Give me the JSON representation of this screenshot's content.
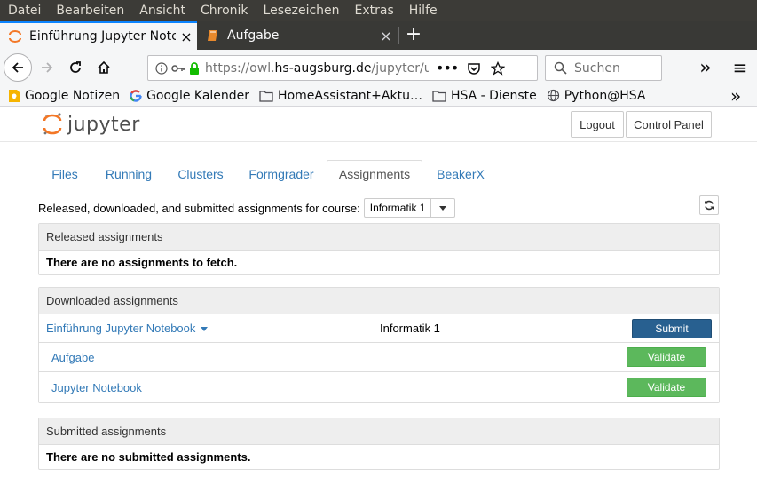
{
  "browser": {
    "menu": [
      "Datei",
      "Bearbeiten",
      "Ansicht",
      "Chronik",
      "Lesezeichen",
      "Extras",
      "Hilfe"
    ],
    "tabs": [
      {
        "title": "Einführung Jupyter Notebook",
        "close": "×"
      },
      {
        "title": "Aufgabe",
        "close": "×"
      }
    ],
    "new_tab": "+",
    "url_prefix": "https://owl.",
    "url_domain": "hs-augsburg.de",
    "url_path": "/jupyter/u",
    "search_placeholder": "Suchen",
    "overflow": "»",
    "menu_icon": "≡",
    "bookmarks": [
      {
        "label": "Google Notizen",
        "icon": "keep-icon"
      },
      {
        "label": "Google Kalender",
        "icon": "google-icon"
      },
      {
        "label": "HomeAssistant+Aktu…",
        "icon": "folder-icon"
      },
      {
        "label": "HSA - Dienste",
        "icon": "folder-icon"
      },
      {
        "label": "Python@HSA",
        "icon": "globe-icon"
      }
    ],
    "bookmarks_overflow": "»"
  },
  "jupyter": {
    "logo_text": "jupyter",
    "logout": "Logout",
    "control_panel": "Control Panel",
    "tabs": [
      "Files",
      "Running",
      "Clusters",
      "Formgrader",
      "Assignments",
      "BeakerX"
    ],
    "active_tab": "Assignments",
    "course_label": "Released, downloaded, and submitted assignments for course:",
    "course_value": "Informatik 1",
    "released": {
      "header": "Released assignments",
      "empty": "There are no assignments to fetch."
    },
    "downloaded": {
      "header": "Downloaded assignments",
      "assignment": "Einführung Jupyter Notebook",
      "course": "Informatik 1",
      "submit": "Submit",
      "notebooks": [
        {
          "name": "Aufgabe",
          "action": "Validate"
        },
        {
          "name": "Jupyter Notebook",
          "action": "Validate"
        }
      ]
    },
    "submitted": {
      "header": "Submitted assignments",
      "empty": "There are no submitted assignments."
    }
  },
  "colors": {
    "link": "#337ab7",
    "submit": "#286090",
    "validate": "#5cb85c",
    "firefox_accent": "#0a84ff"
  }
}
